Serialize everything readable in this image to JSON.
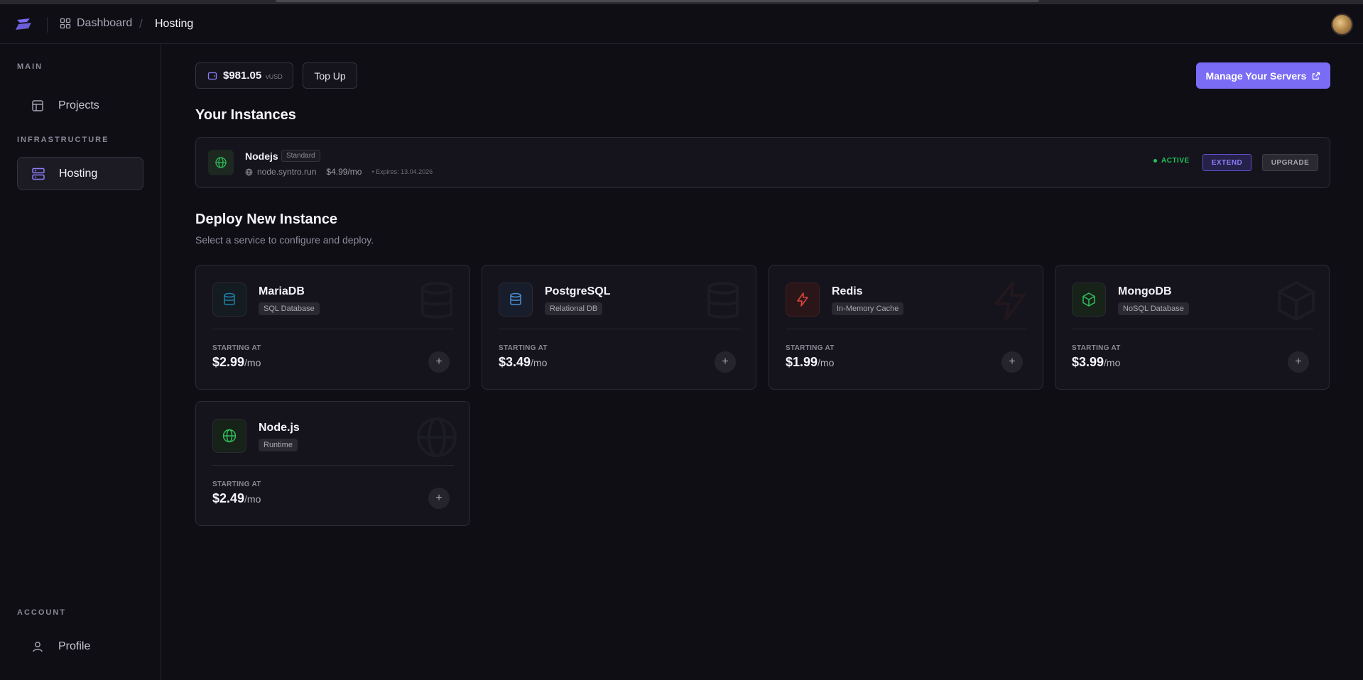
{
  "header": {
    "breadcrumb_dashboard": "Dashboard",
    "breadcrumb_separator": "/",
    "breadcrumb_current": "Hosting"
  },
  "sidebar": {
    "main_label": "MAIN",
    "infrastructure_label": "INFRASTRUCTURE",
    "account_label": "ACCOUNT",
    "items": {
      "projects": "Projects",
      "hosting": "Hosting",
      "profile": "Profile"
    }
  },
  "wallet": {
    "balance": "$981.05",
    "unit": "vUSD",
    "topup_label": "Top Up"
  },
  "manage_label": "Manage Your Servers",
  "instances": {
    "title": "Your Instances",
    "items": [
      {
        "name": "Nodejs",
        "tier": "Standard",
        "domain": "node.syntro.run",
        "price": "$4.99/mo",
        "expires": "• Expires: 13.04.2026",
        "status": "ACTIVE",
        "extend_label": "EXTEND",
        "upgrade_label": "UPGRADE"
      }
    ]
  },
  "deploy": {
    "title": "Deploy New Instance",
    "subtitle": "Select a service to configure and deploy.",
    "starting_label": "STARTING AT",
    "per_month": "/mo",
    "services": [
      {
        "name": "MariaDB",
        "tag": "SQL Database",
        "price": "$2.99",
        "icon": "database-icon",
        "accent": "#1f7fa6"
      },
      {
        "name": "PostgreSQL",
        "tag": "Relational DB",
        "price": "$3.49",
        "icon": "database-icon",
        "accent": "#4d8fd6"
      },
      {
        "name": "Redis",
        "tag": "In-Memory Cache",
        "price": "$1.99",
        "icon": "lightning-icon",
        "accent": "#e0433d"
      },
      {
        "name": "MongoDB",
        "tag": "NoSQL Database",
        "price": "$3.99",
        "icon": "cube-icon",
        "accent": "#2fbf5a"
      },
      {
        "name": "Node.js",
        "tag": "Runtime",
        "price": "$2.49",
        "icon": "globe-icon",
        "accent": "#2fbf5a"
      }
    ]
  },
  "colors": {
    "primary": "#7b6cf6",
    "active_green": "#21c45a",
    "background": "#0f0e15"
  }
}
